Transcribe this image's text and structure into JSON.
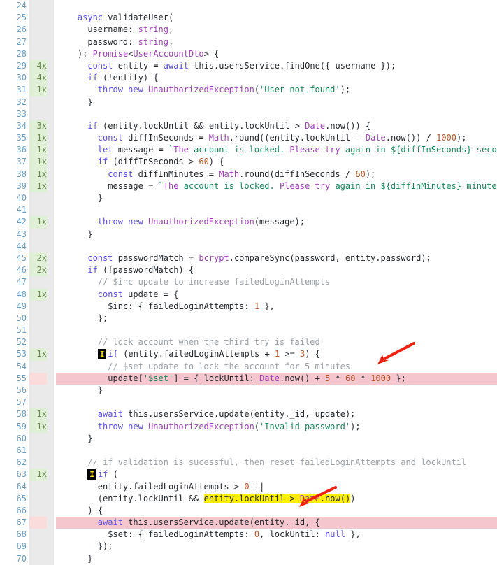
{
  "report": {
    "type": "code-coverage-report",
    "language": "typescript",
    "first_line": 24,
    "last_line": 70,
    "colors": {
      "uncovered_line": "#f6c6ce",
      "uncovered_branch": "#ffee00",
      "covered_gutter": "#e0f0d6",
      "neutral_gutter": "#eaeaea",
      "line_number": "#6a9ec5",
      "annotation_arrow": "#ee2211"
    }
  },
  "lines": [
    {
      "n": "24",
      "hits": "",
      "state": "empty",
      "code": ""
    },
    {
      "n": "25",
      "hits": "",
      "state": "empty",
      "code": "    async validateUser("
    },
    {
      "n": "26",
      "hits": "",
      "state": "empty",
      "code": "      username: string,"
    },
    {
      "n": "27",
      "hits": "",
      "state": "empty",
      "code": "      password: string,"
    },
    {
      "n": "28",
      "hits": "",
      "state": "empty",
      "code": "    ): Promise<UserAccountDto> {"
    },
    {
      "n": "29",
      "hits": "4x",
      "state": "covered",
      "code": "      const entity = await this.usersService.findOne({ username });"
    },
    {
      "n": "30",
      "hits": "4x",
      "state": "covered",
      "code": "      if (!entity) {"
    },
    {
      "n": "31",
      "hits": "1x",
      "state": "covered",
      "code": "        throw new UnauthorizedException('User not found');"
    },
    {
      "n": "32",
      "hits": "",
      "state": "empty",
      "code": "      }"
    },
    {
      "n": "33",
      "hits": "",
      "state": "empty",
      "code": ""
    },
    {
      "n": "34",
      "hits": "3x",
      "state": "covered",
      "code": "      if (entity.lockUntil && entity.lockUntil > Date.now()) {"
    },
    {
      "n": "35",
      "hits": "1x",
      "state": "covered",
      "code": "        const diffInSeconds = Math.round((entity.lockUntil - Date.now()) / 1000);"
    },
    {
      "n": "36",
      "hits": "1x",
      "state": "covered",
      "code": "        let message = `The account is locked. Please try again in ${diffInSeconds} seconds.`;"
    },
    {
      "n": "37",
      "hits": "1x",
      "state": "covered",
      "code": "        if (diffInSeconds > 60) {"
    },
    {
      "n": "38",
      "hits": "1x",
      "state": "covered",
      "code": "          const diffInMinutes = Math.round(diffInSeconds / 60);"
    },
    {
      "n": "39",
      "hits": "1x",
      "state": "covered",
      "code": "          message = `The account is locked. Please try again in ${diffInMinutes} minutes.`;"
    },
    {
      "n": "40",
      "hits": "",
      "state": "empty",
      "code": "        }"
    },
    {
      "n": "41",
      "hits": "",
      "state": "empty",
      "code": ""
    },
    {
      "n": "42",
      "hits": "1x",
      "state": "covered",
      "code": "        throw new UnauthorizedException(message);"
    },
    {
      "n": "43",
      "hits": "",
      "state": "empty",
      "code": "      }"
    },
    {
      "n": "44",
      "hits": "",
      "state": "empty",
      "code": ""
    },
    {
      "n": "45",
      "hits": "2x",
      "state": "covered",
      "code": "      const passwordMatch = bcrypt.compareSync(password, entity.password);"
    },
    {
      "n": "46",
      "hits": "2x",
      "state": "covered",
      "code": "      if (!passwordMatch) {"
    },
    {
      "n": "47",
      "hits": "",
      "state": "empty",
      "code": "        // $inc update to increase failedLoginAttempts"
    },
    {
      "n": "48",
      "hits": "1x",
      "state": "covered",
      "code": "        const update = {"
    },
    {
      "n": "49",
      "hits": "",
      "state": "empty",
      "code": "          $inc: { failedLoginAttempts: 1 },"
    },
    {
      "n": "50",
      "hits": "",
      "state": "empty",
      "code": "        };"
    },
    {
      "n": "51",
      "hits": "",
      "state": "empty",
      "code": ""
    },
    {
      "n": "52",
      "hits": "",
      "state": "empty",
      "code": "        // lock account when the third try is failed"
    },
    {
      "n": "53",
      "hits": "1x",
      "state": "covered",
      "code": "        if (entity.failedLoginAttempts + 1 >= 3) {"
    },
    {
      "n": "54",
      "hits": "",
      "state": "empty",
      "code": "          // $set update to lock the account for 5 minutes"
    },
    {
      "n": "55",
      "hits": "",
      "state": "missed",
      "code": "          update['$set'] = { lockUntil: Date.now() + 5 * 60 * 1000 };"
    },
    {
      "n": "56",
      "hits": "",
      "state": "empty",
      "code": "        }"
    },
    {
      "n": "57",
      "hits": "",
      "state": "empty",
      "code": ""
    },
    {
      "n": "58",
      "hits": "1x",
      "state": "covered",
      "code": "        await this.usersService.update(entity._id, update);"
    },
    {
      "n": "59",
      "hits": "1x",
      "state": "covered",
      "code": "        throw new UnauthorizedException('Invalid password');"
    },
    {
      "n": "60",
      "hits": "",
      "state": "empty",
      "code": "      }"
    },
    {
      "n": "61",
      "hits": "",
      "state": "empty",
      "code": ""
    },
    {
      "n": "62",
      "hits": "",
      "state": "empty",
      "code": "      // if validation is sucessful, then reset failedLoginAttempts and lockUntil"
    },
    {
      "n": "63",
      "hits": "1x",
      "state": "covered",
      "code": "      if ("
    },
    {
      "n": "64",
      "hits": "",
      "state": "empty",
      "code": "        entity.failedLoginAttempts > 0 ||"
    },
    {
      "n": "65",
      "hits": "",
      "state": "empty",
      "code": "        (entity.lockUntil && entity.lockUntil > Date.now())"
    },
    {
      "n": "66",
      "hits": "",
      "state": "empty",
      "code": "      ) {"
    },
    {
      "n": "67",
      "hits": "",
      "state": "missed",
      "code": "        await this.usersService.update(entity._id, {"
    },
    {
      "n": "68",
      "hits": "",
      "state": "empty",
      "code": "          $set: { failedLoginAttempts: 0, lockUntil: null },"
    },
    {
      "n": "69",
      "hits": "",
      "state": "empty",
      "code": "        });"
    },
    {
      "n": "70",
      "hits": "",
      "state": "empty",
      "code": "      }"
    }
  ],
  "branch_markers": [
    {
      "line": "53",
      "label": "I",
      "meaning": "if-path-not-taken"
    },
    {
      "line": "63",
      "label": "I",
      "meaning": "if-path-not-taken"
    }
  ],
  "uncovered_branch_spans": [
    {
      "line": "65",
      "text": "entity.lockUntil > Date.now()"
    }
  ],
  "annotations": [
    {
      "name": "arrow-line-55",
      "points_to_line": "55"
    },
    {
      "name": "arrow-line-67",
      "points_to_line": "67"
    }
  ]
}
